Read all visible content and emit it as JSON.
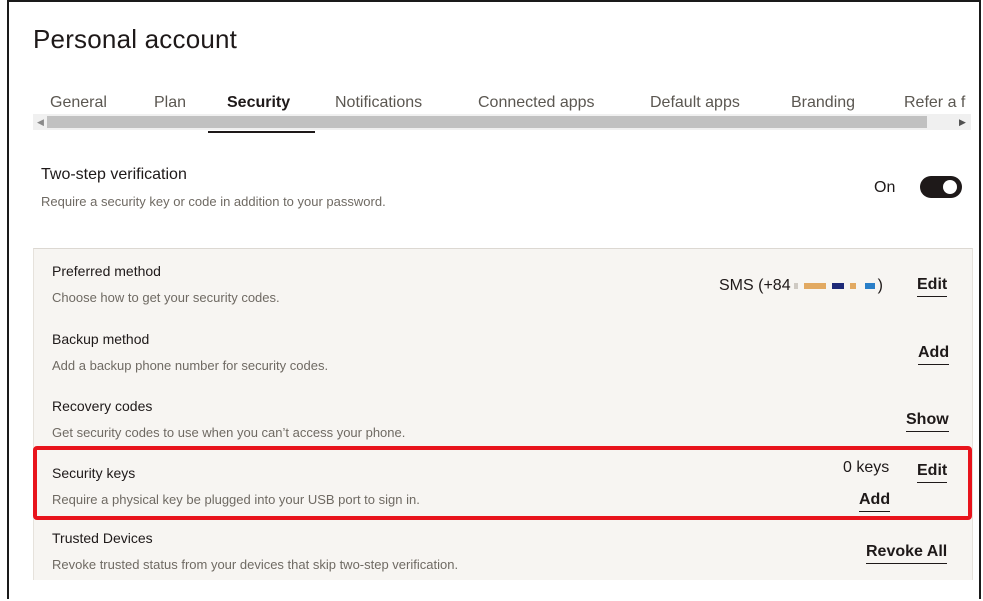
{
  "page": {
    "title": "Personal account"
  },
  "tabs": [
    {
      "label": "General"
    },
    {
      "label": "Plan"
    },
    {
      "label": "Security"
    },
    {
      "label": "Notifications"
    },
    {
      "label": "Connected apps"
    },
    {
      "label": "Default apps"
    },
    {
      "label": "Branding"
    },
    {
      "label": "Refer a f"
    }
  ],
  "two_step": {
    "title": "Two-step verification",
    "description": "Require a security key or code in addition to your password.",
    "state_label": "On",
    "enabled": true
  },
  "rows": {
    "preferred": {
      "title": "Preferred method",
      "description": "Choose how to get your security codes.",
      "value_prefix": "SMS (+84",
      "value_suffix": ")",
      "action": "Edit"
    },
    "backup": {
      "title": "Backup method",
      "description": "Add a backup phone number for security codes.",
      "action": "Add"
    },
    "recovery": {
      "title": "Recovery codes",
      "description": "Get security codes to use when you can’t access your phone.",
      "action": "Show"
    },
    "security_keys": {
      "title": "Security keys",
      "description": "Require a physical key be plugged into your USB port to sign in.",
      "count": "0 keys",
      "edit_action": "Edit",
      "add_action": "Add"
    },
    "trusted": {
      "title": "Trusted Devices",
      "description": "Revoke trusted status from your devices that skip two-step verification.",
      "action": "Revoke All"
    }
  },
  "colors": {
    "highlight": "#e8141c",
    "toggle_on": "#1e1919",
    "panel_bg": "#f7f5f2"
  }
}
